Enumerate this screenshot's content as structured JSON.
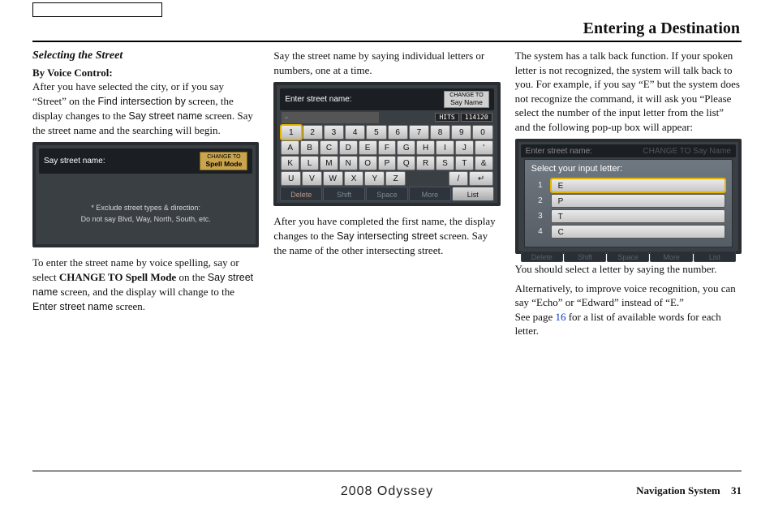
{
  "header": {
    "title": "Entering a Destination"
  },
  "col1": {
    "subhead": "Selecting the Street",
    "byvoice": "By Voice Control:",
    "p1a": "After you have selected the city, or if you say “Street” on the ",
    "p1b": "Find intersection by",
    "p1c": " screen, the display changes to the ",
    "p1d": "Say street name",
    "p1e": " screen. Say the street name and the searching will begin.",
    "shot1": {
      "prompt": "Say street name:",
      "change_l1": "CHANGE TO",
      "change_l2": "Spell Mode",
      "note1": "* Exclude street types & direction:",
      "note2": "Do not say Blvd, Way, North, South, etc."
    },
    "p2a": "To enter the street name by voice spelling, say or select ",
    "p2b": "CHANGE TO Spell Mode",
    "p2c": " on the ",
    "p2d": "Say street name",
    "p2e": " screen, and the display will change to the ",
    "p2f": "Enter street name",
    "p2g": " screen."
  },
  "col2": {
    "p1": "Say the street name by saying individual letters or numbers, one at a time.",
    "shot2": {
      "prompt": "Enter street name:",
      "change_l1": "CHANGE TO",
      "change_l2": "Say Name",
      "dash": "-",
      "hits_label": "HITS",
      "hits_value": "114120",
      "row_num": [
        "1",
        "2",
        "3",
        "4",
        "5",
        "6",
        "7",
        "8",
        "9",
        "0"
      ],
      "row_a": [
        "A",
        "B",
        "C",
        "D",
        "E",
        "F",
        "G",
        "H",
        "I",
        "J",
        "'"
      ],
      "row_k": [
        "K",
        "L",
        "M",
        "N",
        "O",
        "P",
        "Q",
        "R",
        "S",
        "T",
        "&"
      ],
      "row_u": [
        "U",
        "V",
        "W",
        "X",
        "Y",
        "Z",
        "",
        "",
        "/",
        "↵",
        ""
      ],
      "bottom": {
        "del": "Delete",
        "shift": "Shift",
        "space": "Space",
        "more": "More",
        "list": "List"
      }
    },
    "p2a": "After you have completed the first name, the display changes to the ",
    "p2b": "Say intersecting street",
    "p2c": " screen. Say the name of the other intersecting street."
  },
  "col3": {
    "p1": "The system has a talk back function. If your spoken letter is not recognized, the system will talk back to you. For example, if you say “E” but the system does not recognize the command, it will ask you “Please select the number of the input letter from the list” and the following pop-up box will appear:",
    "shot3": {
      "promptdim": "Enter street name:",
      "changedim": "Say Name",
      "change_l1": "CHANGE TO",
      "title": "Select your input letter:",
      "options": [
        {
          "num": "1",
          "letter": "E"
        },
        {
          "num": "2",
          "letter": "P"
        },
        {
          "num": "3",
          "letter": "T"
        },
        {
          "num": "4",
          "letter": "C"
        }
      ],
      "bottom": {
        "del": "Delete",
        "shift": "Shift",
        "space": "Space",
        "more": "More",
        "list": "List"
      }
    },
    "p2": "You should select a letter by saying the number.",
    "p3a": "Alternatively, to improve voice recognition, you can say “Echo” or “Edward” instead of “E.”",
    "p3b": "See page ",
    "p3c": "16",
    "p3d": " for a list of available words for each letter."
  },
  "footer": {
    "model": "2008  Odyssey",
    "navsys": "Navigation System",
    "page": "31"
  }
}
